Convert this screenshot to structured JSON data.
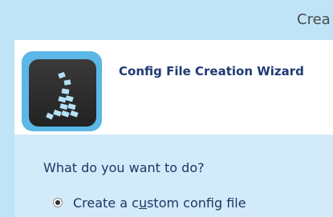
{
  "window": {
    "title_partial": "Crea"
  },
  "header": {
    "title": "Config File Creation Wizard",
    "icon": "wizard-app-icon"
  },
  "content": {
    "question": "What do you want to do?",
    "option_1": {
      "label_before": "Create a c",
      "label_mnemonic": "u",
      "label_after": "stom config file",
      "selected": true
    }
  },
  "colors": {
    "frame": "#bfe3f7",
    "content_bg": "#d3eafb",
    "title_text": "#203a73",
    "body_text": "#1d3763",
    "icon_border": "#5ab7e6"
  }
}
